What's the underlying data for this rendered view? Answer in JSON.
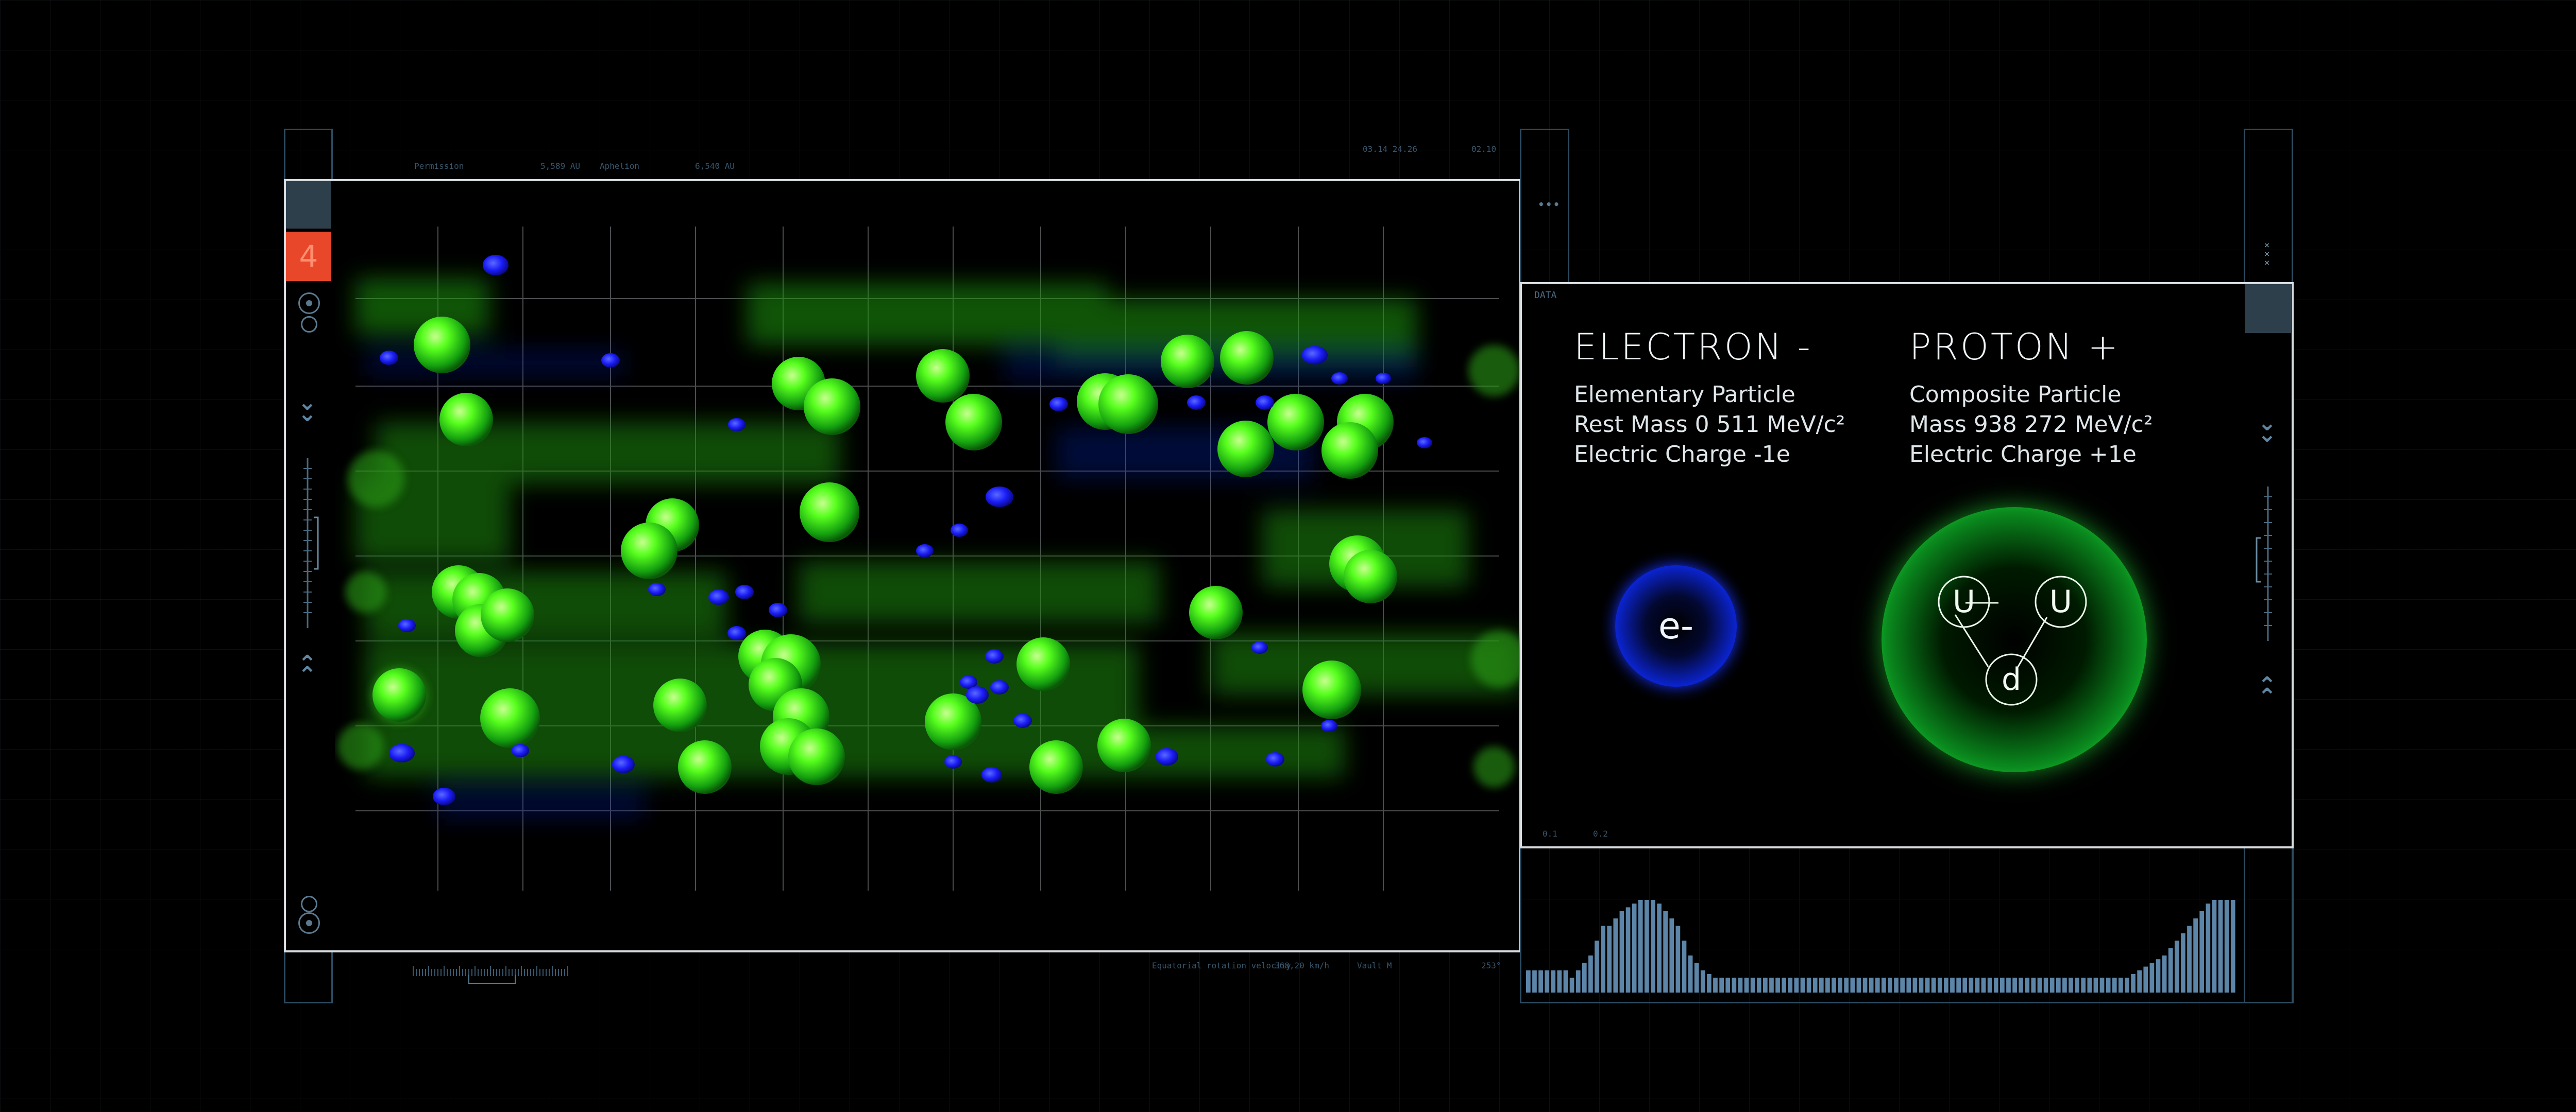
{
  "left_panel": {
    "badge": "4",
    "header_left": [
      "Permission",
      "5,589 AU",
      "Aphelion",
      "6,540 AU"
    ],
    "header_right": [
      "03.14 24.26",
      "02.10"
    ],
    "footer": [
      "Equatorial rotation velocity",
      "368,20 km/h",
      "Vault M",
      "253°"
    ]
  },
  "right_panel": {
    "label": "DATA",
    "dots": "•••",
    "scale_labels": [
      "0.1",
      "0.2"
    ],
    "electron": {
      "title": "ELECTRON -",
      "line1": "Elementary Particle",
      "line2": "Rest Mass 0 511 MeV/c²",
      "line3": "Electric Charge -1e",
      "symbol": "e-"
    },
    "proton": {
      "title": "PROTON +",
      "line1": "Composite Particle",
      "line2": "Mass 938 272 MeV/c²",
      "line3": "Electric Charge +1e",
      "quarks": [
        "U",
        "U",
        "d"
      ]
    }
  },
  "histogram": {
    "values": [
      0.24,
      0.24,
      0.24,
      0.24,
      0.24,
      0.24,
      0.24,
      0.16,
      0.24,
      0.32,
      0.4,
      0.56,
      0.72,
      0.72,
      0.8,
      0.88,
      0.92,
      0.96,
      1.0,
      1.0,
      1.0,
      0.96,
      0.88,
      0.8,
      0.72,
      0.56,
      0.4,
      0.32,
      0.24,
      0.2,
      0.16,
      0.16,
      0.16,
      0.16,
      0.16,
      0.16,
      0.16,
      0.16,
      0.16,
      0.16,
      0.16,
      0.16,
      0.16,
      0.16,
      0.16,
      0.16,
      0.16,
      0.16,
      0.16,
      0.16,
      0.16,
      0.16,
      0.16,
      0.16,
      0.16,
      0.16,
      0.16,
      0.16,
      0.16,
      0.16,
      0.16,
      0.16,
      0.16,
      0.16,
      0.16,
      0.16,
      0.16,
      0.16,
      0.16,
      0.16,
      0.16,
      0.16,
      0.16,
      0.16,
      0.16,
      0.16,
      0.16,
      0.16,
      0.16,
      0.16,
      0.16,
      0.16,
      0.16,
      0.16,
      0.16,
      0.16,
      0.16,
      0.16,
      0.16,
      0.16,
      0.16,
      0.16,
      0.16,
      0.16,
      0.16,
      0.16,
      0.16,
      0.2,
      0.24,
      0.28,
      0.32,
      0.36,
      0.4,
      0.48,
      0.56,
      0.64,
      0.72,
      0.8,
      0.88,
      0.96,
      1.0,
      1.0,
      1.0,
      1.0
    ],
    "color": "#5c85a8"
  },
  "colors": {
    "proton_green": "#3cff28",
    "electron_blue": "#1a28ff",
    "frame": "#d8dde0",
    "rail": "#2c4c62",
    "badge": "#e8472a"
  }
}
